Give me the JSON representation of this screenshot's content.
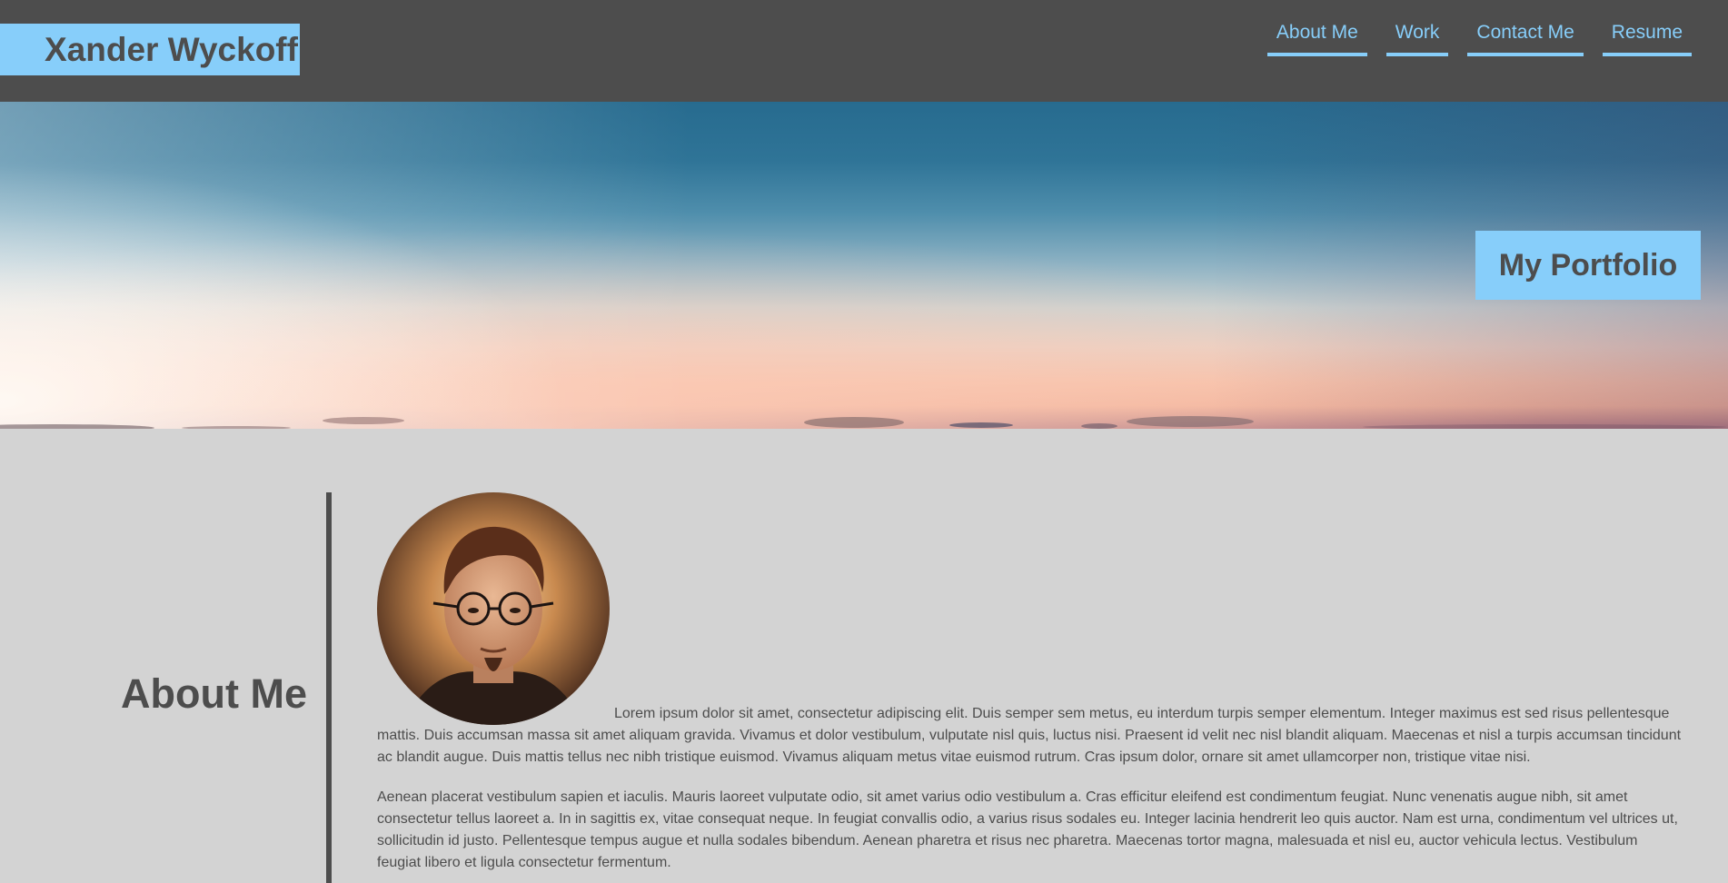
{
  "header": {
    "brand": "Xander Wyckoff",
    "nav": [
      {
        "label": "About Me"
      },
      {
        "label": "Work"
      },
      {
        "label": "Contact Me"
      },
      {
        "label": "Resume"
      }
    ]
  },
  "hero": {
    "badge": "My Portfolio"
  },
  "about": {
    "heading": "About Me",
    "paragraphs": [
      "Lorem ipsum dolor sit amet, consectetur adipiscing elit. Duis semper sem metus, eu interdum turpis semper elementum. Integer maximus est sed risus pellentesque mattis. Duis accumsan massa sit amet aliquam gravida. Vivamus et dolor vestibulum, vulputate nisl quis, luctus nisi. Praesent id velit nec nisl blandit aliquam. Maecenas et nisl a turpis accumsan tincidunt ac blandit augue. Duis mattis tellus nec nibh tristique euismod. Vivamus aliquam metus vitae euismod rutrum. Cras ipsum dolor, ornare sit amet ullamcorper non, tristique vitae nisi.",
      "Aenean placerat vestibulum sapien et iaculis. Mauris laoreet vulputate odio, sit amet varius odio vestibulum a. Cras efficitur eleifend est condimentum feugiat. Nunc venenatis augue nibh, sit amet consectetur tellus laoreet a. In in sagittis ex, vitae consequat neque. In feugiat convallis odio, a varius risus sodales eu. Integer lacinia hendrerit leo quis auctor. Nam est urna, condimentum vel ultrices ut, sollicitudin id justo. Pellentesque tempus augue et nulla sodales bibendum. Aenean pharetra et risus nec pharetra. Maecenas tortor magna, malesuada et nisl eu, auctor vehicula lectus. Vestibulum feugiat libero et ligula consectetur fermentum."
    ]
  },
  "colors": {
    "header_bg": "#4d4d4d",
    "accent": "#87cefa",
    "page_bg": "#d3d3d3",
    "text": "#4d4d4d"
  }
}
